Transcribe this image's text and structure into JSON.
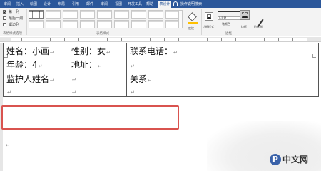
{
  "ribbon": {
    "tabs": [
      {
        "label": "审阅"
      },
      {
        "label": "插入"
      },
      {
        "label": "绘图"
      },
      {
        "label": "设计"
      },
      {
        "label": "布局"
      },
      {
        "label": "引用"
      },
      {
        "label": "邮件"
      },
      {
        "label": "审阅"
      },
      {
        "label": "视图"
      },
      {
        "label": "开发工具"
      },
      {
        "label": "帮助"
      },
      {
        "label": "表设计"
      },
      {
        "label": "布局"
      }
    ],
    "active_tab_index": 11,
    "tell_me": "操作说明搜索",
    "style_options": [
      {
        "label": "第一列",
        "checked": true
      },
      {
        "label": "最后一列",
        "checked": false
      },
      {
        "label": "镶边列",
        "checked": false
      }
    ],
    "group_labels": {
      "options": "表格样式选项",
      "styles": "表格样式",
      "borders": "边框"
    },
    "shading_label": "底纹",
    "border_styles_label": "边框样式",
    "line_weight": "0.5 磅",
    "pen_color_label": "笔颜色",
    "borders_btn_label": "边框",
    "painter_label": "边框刷",
    "accent_color": "#2b579a"
  },
  "document": {
    "rows": [
      [
        "姓名：小画",
        "性别：女",
        "联系电话："
      ],
      [
        "年龄：4",
        "地址：",
        ""
      ],
      [
        "监护人姓名",
        "",
        "关系"
      ],
      [
        "",
        "",
        ""
      ]
    ],
    "paragraph_mark": "↵"
  },
  "watermark": {
    "text": "中文网"
  }
}
